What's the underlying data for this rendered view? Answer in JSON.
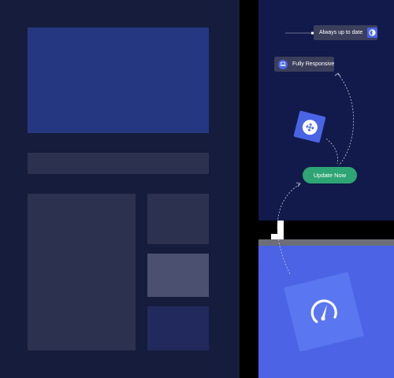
{
  "features": {
    "always_up_to_date": {
      "label": "Always up to date",
      "icon": "half-circle-icon"
    },
    "fully_responsive": {
      "label": "Fully Responsive",
      "icon": "laptop-icon"
    }
  },
  "move_card": {
    "icon": "move-arrows-icon"
  },
  "update_button": {
    "label": "Update Now"
  },
  "speed_card": {
    "icon": "speedometer-icon"
  },
  "colors": {
    "page_background": "#161c3c",
    "dark_panel": "#111a4a",
    "accent_blue": "#4a64e6",
    "panel_blue": "#4b63e4",
    "button_green": "#2ea574"
  }
}
